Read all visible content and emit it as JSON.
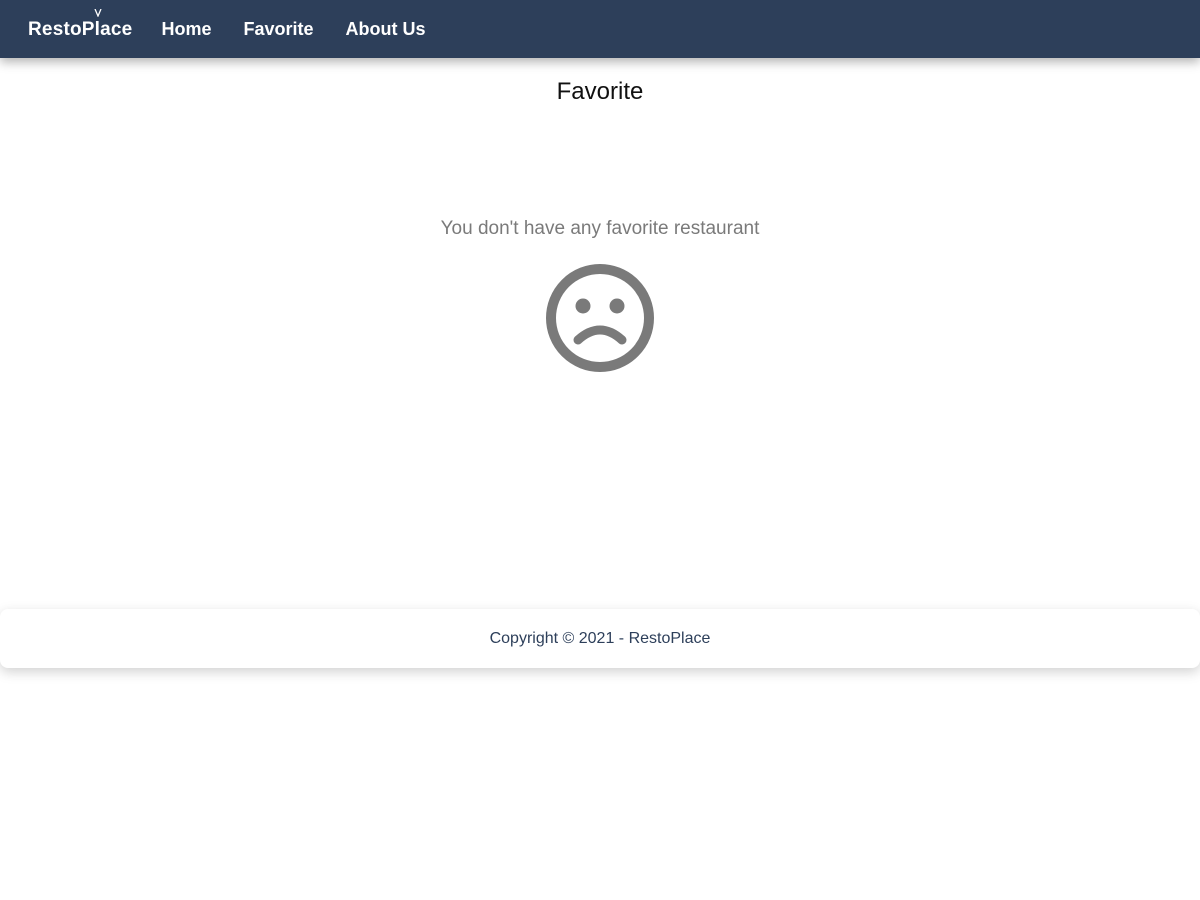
{
  "header": {
    "brand": "RestoPlace",
    "nav": [
      {
        "label": "Home"
      },
      {
        "label": "Favorite"
      },
      {
        "label": "About Us"
      }
    ]
  },
  "main": {
    "title": "Favorite",
    "empty_message": "You don't have any favorite restaurant",
    "empty_icon": "sad-face-icon"
  },
  "footer": {
    "text": "Copyright © 2021 - RestoPlace"
  },
  "colors": {
    "navbar_bg": "#2d3f5a",
    "nav_text": "#ffffff",
    "muted_text": "#7a7a7a",
    "footer_text": "#2d3f5a"
  }
}
